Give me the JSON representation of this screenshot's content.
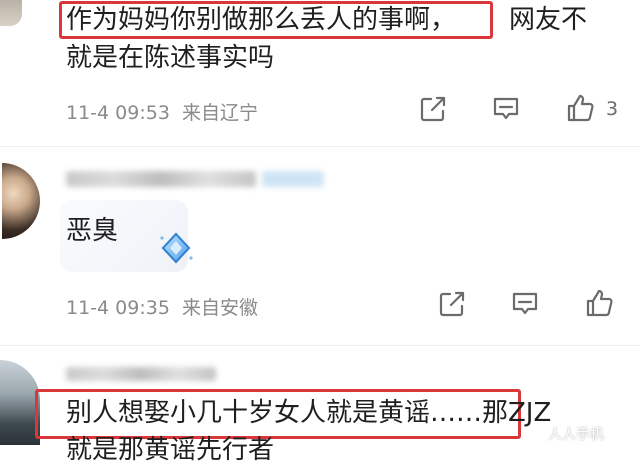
{
  "comment1": {
    "highlighted_text": "作为妈妈你别做那么丢人的事啊，",
    "text_rest_line1": "网友不",
    "text_line2": "就是在陈述事实吗",
    "time": "11-4 09:53",
    "location": "来自辽宁",
    "like_count": "3"
  },
  "comment2": {
    "text": "恶臭",
    "time": "11-4 09:35",
    "location": "来自安徽"
  },
  "comment3": {
    "highlighted_text": "别人想娶小几十岁女人就是黄谣……那ZJZ",
    "line2_partial": "就是那黄谣先行者"
  },
  "watermark": "人人手机",
  "colors": {
    "highlight": "#d9373a",
    "meta": "#8a8a8a",
    "icon": "#6b6b6b"
  },
  "icons": [
    "share-icon",
    "comment-icon",
    "like-icon",
    "diamond-sticker-icon"
  ]
}
